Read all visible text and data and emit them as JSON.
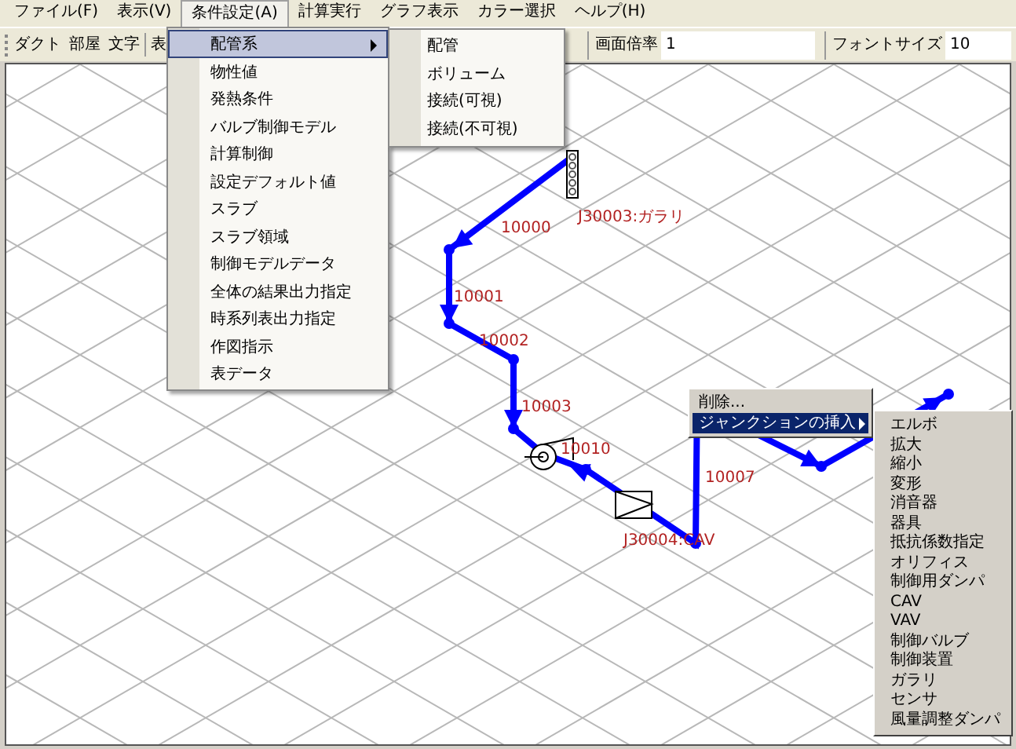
{
  "menubar": [
    {
      "label": "ファイル(F)",
      "selected": false
    },
    {
      "label": "表示(V)",
      "selected": false
    },
    {
      "label": "条件設定(A)",
      "selected": true
    },
    {
      "label": "計算実行",
      "selected": false
    },
    {
      "label": "グラフ表示",
      "selected": false
    },
    {
      "label": "カラー選択",
      "selected": false
    },
    {
      "label": "ヘルプ(H)",
      "selected": false
    }
  ],
  "toolbar": {
    "buttons": [
      "ダクト",
      "部屋",
      "文字",
      "表"
    ],
    "fields": [
      {
        "label": "画面倍率",
        "value": "1"
      },
      {
        "label": "フォントサイズ",
        "value": "10"
      }
    ]
  },
  "dropdown_menu": [
    {
      "label": "配管系",
      "submenu": true,
      "selected": true
    },
    {
      "label": "物性値",
      "submenu": false,
      "selected": false
    },
    {
      "label": "発熱条件",
      "submenu": false,
      "selected": false
    },
    {
      "label": "バルブ制御モデル",
      "submenu": false,
      "selected": false
    },
    {
      "label": "計算制御",
      "submenu": false,
      "selected": false
    },
    {
      "label": "設定デフォルト値",
      "submenu": false,
      "selected": false
    },
    {
      "label": "スラブ",
      "submenu": false,
      "selected": false
    },
    {
      "label": "スラブ領域",
      "submenu": false,
      "selected": false
    },
    {
      "label": "制御モデルデータ",
      "submenu": false,
      "selected": false
    },
    {
      "label": "全体の結果出力指定",
      "submenu": false,
      "selected": false
    },
    {
      "label": "時系列表出力指定",
      "submenu": false,
      "selected": false
    },
    {
      "label": "作図指示",
      "submenu": false,
      "selected": false
    },
    {
      "label": "表データ",
      "submenu": false,
      "selected": false
    }
  ],
  "submenu": [
    "配管",
    "ボリューム",
    "接続(可視)",
    "接続(不可視)"
  ],
  "diagram": {
    "labels": [
      "10000",
      "J30003:ガラリ",
      "10001",
      "10002",
      "10003",
      "10010",
      "J30004:CAV",
      "10007"
    ]
  },
  "context_menu": [
    {
      "label": "削除...",
      "submenu": false,
      "selected": false
    },
    {
      "label": "ジャンクションの挿入",
      "submenu": true,
      "selected": true
    }
  ],
  "junction_submenu": [
    "エルボ",
    "拡大",
    "縮小",
    "変形",
    "消音器",
    "器具",
    "抵抗係数指定",
    "オリフィス",
    "制御用ダンパ",
    "CAV",
    "VAV",
    "制御バルブ",
    "制御装置",
    "ガラリ",
    "センサ",
    "風量調整ダンパ"
  ]
}
